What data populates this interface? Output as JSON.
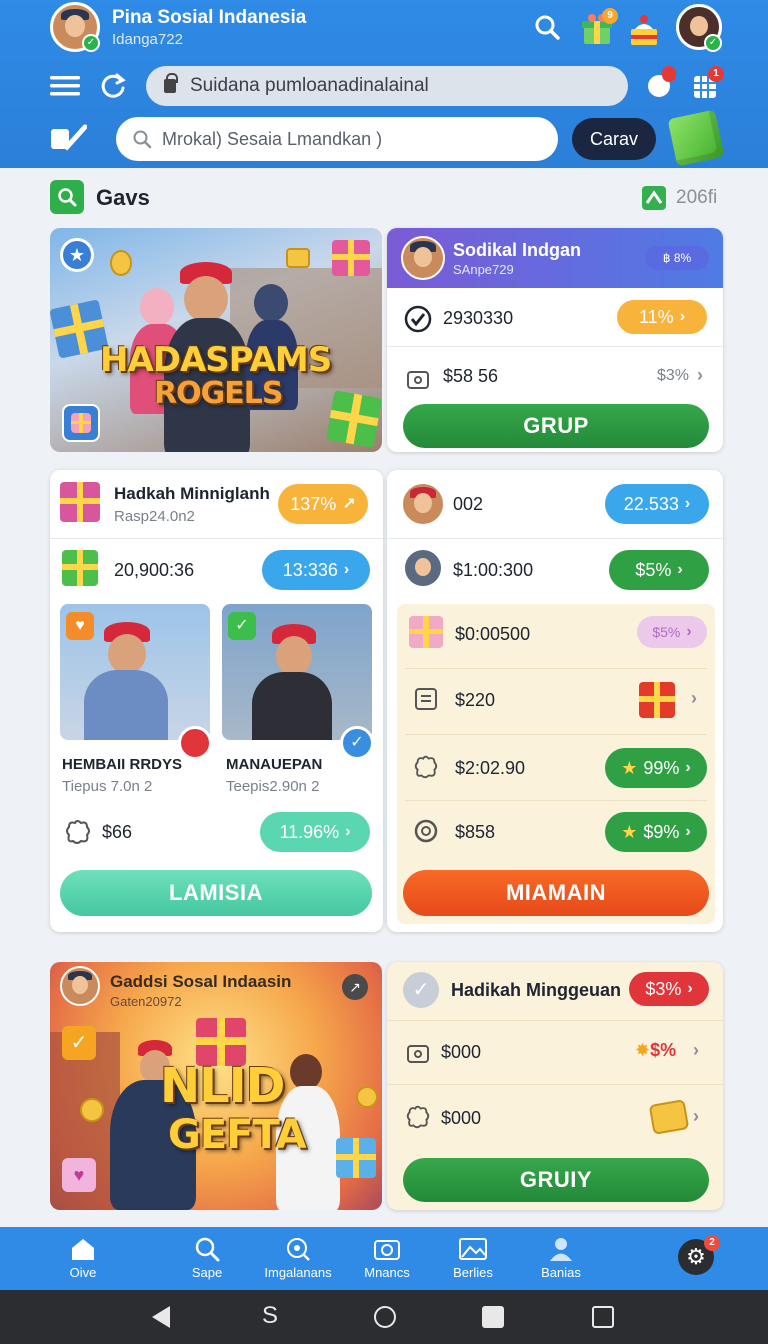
{
  "header": {
    "title": "Pina Sosial Indanesia",
    "subtitle": "Idanga722",
    "url": "Suidana pumloanadinalainal",
    "search_placeholder": "Mrokal) Sesaia Lmandkan )",
    "search_button": "Carav",
    "gift_badge": "9",
    "notif_badge_1": "",
    "notif_badge_2": "1"
  },
  "section": {
    "title": "Gavs",
    "count": "206fi"
  },
  "promo_card": {
    "banner_line1": "HADASPAMS",
    "banner_line2": "ROGELS",
    "title": "Sodikal Indgan",
    "subtitle": "SAnpe729",
    "tag": "฿ 8%",
    "row1_value": "2930330",
    "row1_pill": "11%",
    "row2_value": "$58 56",
    "row2_meta": "$3%",
    "button": "GRUP"
  },
  "left_card": {
    "title": "Hadkah Minniglanh",
    "subtitle": "Rasp24.0n2",
    "title_pill": "137%",
    "row_value": "20,900:36",
    "row_pill": "13:336",
    "players": [
      {
        "name": "HEMBAII RRDYS",
        "meta": "Tiepus 7.0n 2"
      },
      {
        "name": "MANAUEPAN",
        "meta": "Teepis2.90n 2"
      }
    ],
    "bottom_value": "$66",
    "bottom_pill": "11.96%",
    "button": "LAMISIA"
  },
  "right_card": {
    "title": "002",
    "title_pill": "22.533",
    "row_value": "$1:00:300",
    "row_pill": "$5%",
    "list": [
      {
        "value": "$0:00500",
        "pill": "$5%"
      },
      {
        "value": "$220",
        "pill": ""
      },
      {
        "value": "$2:02.90",
        "pill": "99%"
      },
      {
        "value": "$858",
        "pill": "$9%"
      }
    ],
    "button": "MIAMAIN"
  },
  "promo2": {
    "title": "Gaddsi Sosal Indaasin",
    "subtitle": "Gaten20972",
    "banner_line1": "NLID",
    "banner_line2": "GEFTA"
  },
  "gift_card": {
    "title": "Hadikah Minggeuan",
    "title_pill": "$3%",
    "row1_value": "$000",
    "row1_meta": "$%",
    "row2_value": "$000",
    "button": "GRUIY"
  },
  "nav": {
    "items": [
      "Oive",
      "Sape",
      "Imgalanans",
      "Mnancs",
      "Berlies",
      "Banias"
    ],
    "settings_badge": "2"
  },
  "colors": {
    "brand_blue": "#2f8be6",
    "green": "#2fa043",
    "orange": "#f7a62e",
    "sky": "#3aa7ec",
    "red_orange": "#f0551f",
    "mint": "#5ad7b0"
  }
}
